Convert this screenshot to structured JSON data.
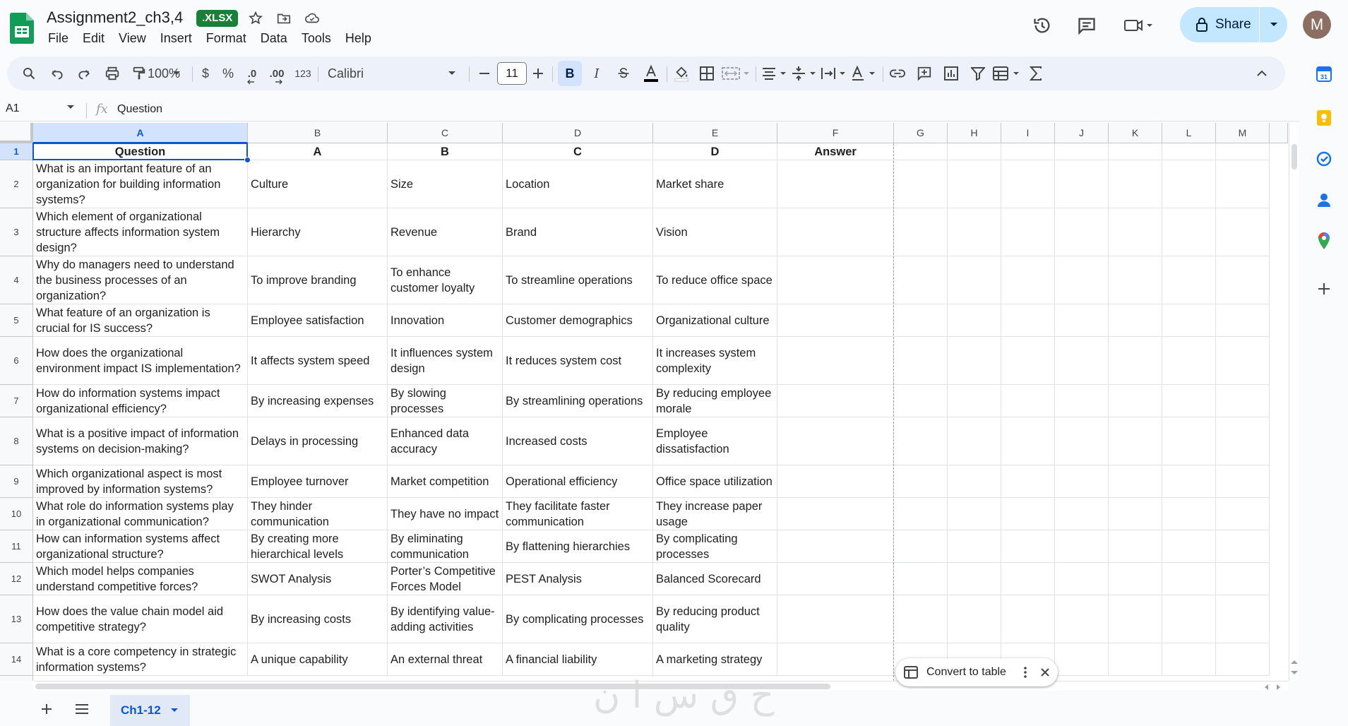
{
  "doc": {
    "title": "Assignment2_ch3,4",
    "badge": ".XLSX",
    "avatar_initial": "M",
    "share_label": "Share"
  },
  "menu": [
    "File",
    "Edit",
    "View",
    "Insert",
    "Format",
    "Data",
    "Tools",
    "Help"
  ],
  "toolbar": {
    "zoom": "100%",
    "currency": "$",
    "percent": "%",
    "dec_decrease": ".0",
    "dec_increase": ".00",
    "number_format": "123",
    "font": "Calibri",
    "font_size": "11",
    "bold": "B",
    "italic": "I"
  },
  "formula_bar": {
    "cell_ref": "A1",
    "fx": "fx",
    "content": "Question"
  },
  "columns": [
    "A",
    "B",
    "C",
    "D",
    "E",
    "F",
    "G",
    "H",
    "I",
    "J",
    "K",
    "L",
    "M"
  ],
  "rows": [
    {
      "num": "1",
      "cells": [
        "Question",
        "A",
        "B",
        "C",
        "D",
        "Answer"
      ]
    },
    {
      "num": "2",
      "cells": [
        "What is an important feature of an organization for building information systems?",
        "Culture",
        "Size",
        "Location",
        "Market share",
        ""
      ]
    },
    {
      "num": "3",
      "cells": [
        "Which element of organizational structure affects information system design?",
        "Hierarchy",
        "Revenue",
        "Brand",
        "Vision",
        ""
      ]
    },
    {
      "num": "4",
      "cells": [
        "Why do managers need to understand the business processes of an organization?",
        "To improve branding",
        "To enhance customer loyalty",
        "To streamline operations",
        "To reduce office space",
        ""
      ]
    },
    {
      "num": "5",
      "cells": [
        "What feature of an organization is crucial for IS success?",
        "Employee satisfaction",
        "Innovation",
        "Customer demographics",
        "Organizational culture",
        ""
      ]
    },
    {
      "num": "6",
      "cells": [
        "How does the organizational environment impact IS implementation?",
        "It affects system speed",
        "It influences system design",
        "It reduces system cost",
        "It increases system complexity",
        ""
      ]
    },
    {
      "num": "7",
      "cells": [
        "How do information systems impact organizational efficiency?",
        "By increasing expenses",
        "By slowing processes",
        "By streamlining operations",
        "By reducing employee morale",
        ""
      ]
    },
    {
      "num": "8",
      "cells": [
        "What is a positive impact of information systems on decision-making?",
        "Delays in processing",
        "Enhanced data accuracy",
        "Increased costs",
        "Employee dissatisfaction",
        ""
      ]
    },
    {
      "num": "9",
      "cells": [
        "Which organizational aspect is most improved by information systems?",
        "Employee turnover",
        "Market competition",
        "Operational efficiency",
        "Office space utilization",
        ""
      ]
    },
    {
      "num": "10",
      "cells": [
        "What role do information systems play in organizational communication?",
        "They hinder communication",
        "They have no impact",
        "They facilitate faster communication",
        "They increase paper usage",
        ""
      ]
    },
    {
      "num": "11",
      "cells": [
        "How can information systems affect organizational structure?",
        "By creating more hierarchical levels",
        "By eliminating communication",
        "By flattening hierarchies",
        "By complicating processes",
        ""
      ]
    },
    {
      "num": "12",
      "cells": [
        "Which model helps companies understand competitive forces?",
        "SWOT Analysis",
        "Porter’s Competitive Forces Model",
        "PEST Analysis",
        "Balanced Scorecard",
        ""
      ]
    },
    {
      "num": "13",
      "cells": [
        "How does the value chain model aid competitive strategy?",
        "By increasing costs",
        "By identifying value-adding activities",
        "By complicating processes",
        "By reducing product quality",
        ""
      ]
    },
    {
      "num": "14",
      "cells": [
        "What is a core competency in strategic information systems?",
        "A unique capability",
        "An external threat",
        "A financial liability",
        "A marketing strategy",
        ""
      ]
    }
  ],
  "chip": {
    "label": "Convert to table"
  },
  "sheet_tab": {
    "label": "Ch1-12"
  },
  "watermark": "خ ق س ا ن",
  "colors": {
    "accent": "#0b57d0",
    "sheets_green": "#188038",
    "share_bg": "#c2e7ff"
  }
}
